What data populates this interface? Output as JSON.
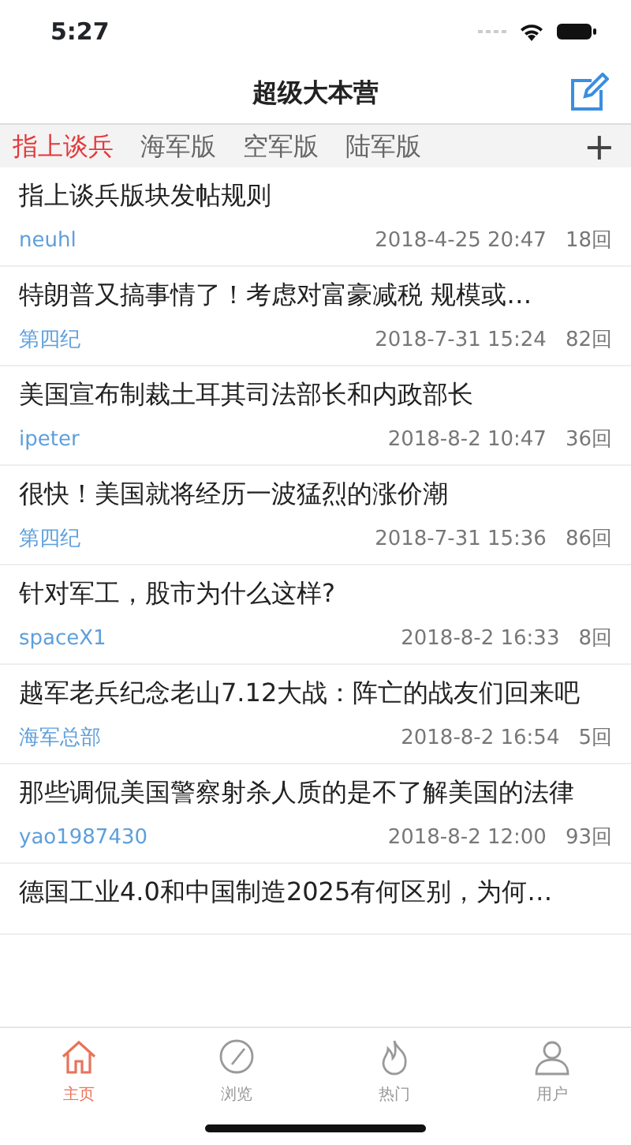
{
  "status_bar": {
    "time": "5:27"
  },
  "header": {
    "title": "超级大本营"
  },
  "tabs": [
    {
      "label": "指上谈兵",
      "selected": true
    },
    {
      "label": "海军版",
      "selected": false
    },
    {
      "label": "空军版",
      "selected": false
    },
    {
      "label": "陆军版",
      "selected": false
    }
  ],
  "add_tab": "+",
  "posts": [
    {
      "title": "指上谈兵版块发帖规则",
      "author": "neuhl",
      "date": "2018-4-25 20:47",
      "replies": "18回"
    },
    {
      "title": "特朗普又搞事情了！考虑对富豪减税 规模或…",
      "author": "第四纪",
      "date": "2018-7-31 15:24",
      "replies": "82回"
    },
    {
      "title": "美国宣布制裁土耳其司法部长和内政部长",
      "author": "ipeter",
      "date": "2018-8-2 10:47",
      "replies": "36回"
    },
    {
      "title": "很快！美国就将经历一波猛烈的涨价潮",
      "author": "第四纪",
      "date": "2018-7-31 15:36",
      "replies": "86回"
    },
    {
      "title": "针对军工，股市为什么这样?",
      "author": "spaceX1",
      "date": "2018-8-2 16:33",
      "replies": "8回"
    },
    {
      "title": "越军老兵纪念老山7.12大战：阵亡的战友们回来吧",
      "author": "海军总部",
      "date": "2018-8-2 16:54",
      "replies": "5回"
    },
    {
      "title": "那些调侃美国警察射杀人质的是不了解美国的法律",
      "author": "yao1987430",
      "date": "2018-8-2 12:00",
      "replies": "93回"
    },
    {
      "title": "德国工业4.0和中国制造2025有何区别，为何…"
    }
  ],
  "bottom_nav": [
    {
      "label": "主页",
      "selected": true
    },
    {
      "label": "浏览",
      "selected": false
    },
    {
      "label": "热门",
      "selected": false
    },
    {
      "label": "用户",
      "selected": false
    }
  ]
}
